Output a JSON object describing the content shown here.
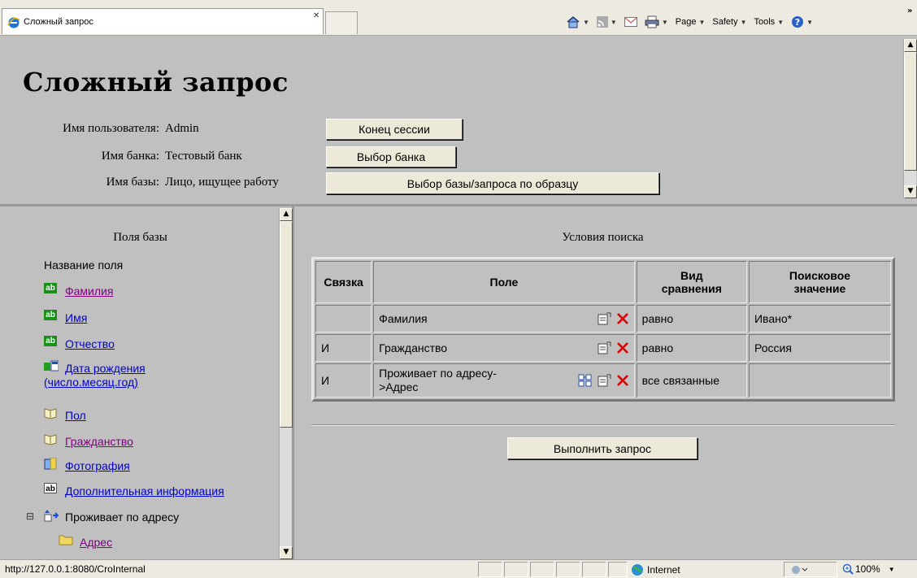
{
  "browser": {
    "tab_title": "Сложный запрос",
    "commands": {
      "page": "Page",
      "safety": "Safety",
      "tools": "Tools"
    }
  },
  "header": {
    "title": "Сложный запрос",
    "user_label": "Имя пользователя:",
    "user_value": "Admin",
    "bank_label": "Имя банка:",
    "bank_value": "Тестовый банк",
    "db_label": "Имя базы:",
    "db_value": "Лицо, ищущее работу",
    "btn_end_session": "Конец сессии",
    "btn_select_bank": "Выбор банка",
    "btn_select_db": "Выбор базы/запроса по образцу"
  },
  "left": {
    "title": "Поля базы",
    "subtitle": "Название поля",
    "fields": [
      {
        "label": "Фамилия",
        "icon": "text-field-icon",
        "visited": true
      },
      {
        "label": "Имя",
        "icon": "text-field-icon",
        "visited": false
      },
      {
        "label": "Отчество",
        "icon": "text-field-icon",
        "visited": false
      },
      {
        "label": "Дата рождения",
        "label2": "(число.месяц.год)",
        "icon": "date-field-icon",
        "visited": false
      },
      {
        "label": "Пол",
        "icon": "dictionary-field-icon",
        "visited": false
      },
      {
        "label": "Гражданство",
        "icon": "dictionary-field-icon",
        "visited": true
      },
      {
        "label": "Фотография",
        "icon": "image-field-icon",
        "visited": false
      },
      {
        "label": "Дополнительная информация",
        "icon": "memo-field-icon",
        "visited": false
      }
    ],
    "group": {
      "label": "Проживает по адресу",
      "expand": "⊟"
    },
    "subfield": {
      "label": "Адрес",
      "visited": true
    }
  },
  "right": {
    "title": "Условия поиска",
    "columns": [
      "Связка",
      "Поле",
      "Вид сравнения",
      "Поисковое значение"
    ],
    "column_lines": [
      [
        "Связка"
      ],
      [
        "Поле"
      ],
      [
        "Вид",
        "сравнения"
      ],
      [
        "Поисковое",
        "значение"
      ]
    ],
    "rows": [
      {
        "link": "",
        "field": "Фамилия",
        "field2": "",
        "comparison": "равно",
        "value": "Ивано*",
        "has_link_icon": false
      },
      {
        "link": "И",
        "field": "Гражданство",
        "field2": "",
        "comparison": "равно",
        "value": "Россия",
        "has_link_icon": false
      },
      {
        "link": "И",
        "field": "Проживает по адресу-",
        "field2": ">Адрес",
        "comparison": "все связанные",
        "value": "",
        "has_link_icon": true
      }
    ],
    "run_button": "Выполнить запрос"
  },
  "status": {
    "url": "http://127.0.0.1:8080/CroInternal",
    "zone": "Internet",
    "zoom": "100%"
  },
  "colors": {
    "link": "#0000cc",
    "visited": "#800080",
    "frame_bg": "#c0c0c0",
    "delete_red": "#dd0000"
  }
}
